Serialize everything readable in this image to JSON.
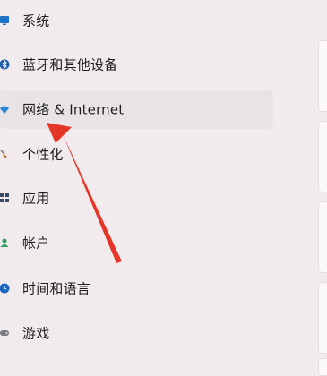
{
  "sidebar": {
    "items": [
      {
        "label": "系统",
        "icon": "display-icon"
      },
      {
        "label": "蓝牙和其他设备",
        "icon": "bluetooth-icon"
      },
      {
        "label": "网络 & Internet",
        "icon": "wifi-icon",
        "selected": true
      },
      {
        "label": "个性化",
        "icon": "brush-icon"
      },
      {
        "label": "应用",
        "icon": "apps-icon"
      },
      {
        "label": "帐户",
        "icon": "person-icon"
      },
      {
        "label": "时间和语言",
        "icon": "globe-clock-icon"
      },
      {
        "label": "游戏",
        "icon": "gamepad-icon"
      }
    ]
  },
  "colors": {
    "background": "#f2ebee",
    "selected_bg": "#e9e3e6",
    "accent": "#0067c0",
    "annotation_arrow": "#e53527"
  }
}
